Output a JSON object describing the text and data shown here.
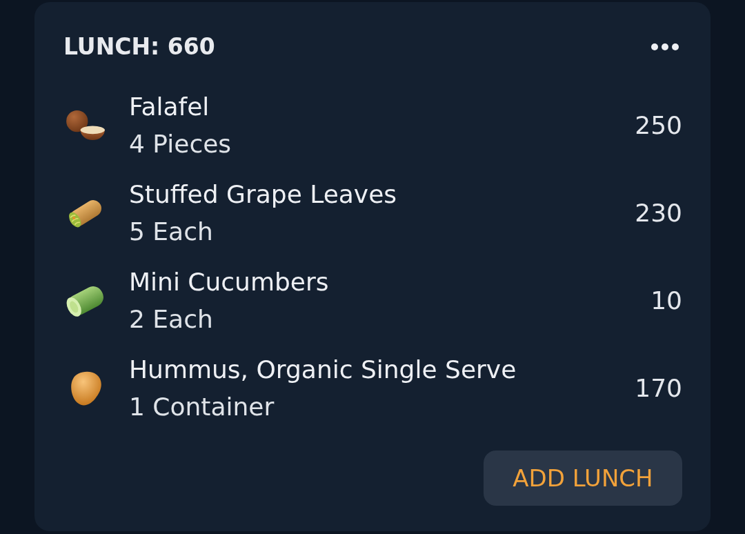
{
  "meal": {
    "title": "LUNCH: 660",
    "items": [
      {
        "name": "Falafel",
        "serving": "4 Pieces",
        "calories": "250"
      },
      {
        "name": "Stuffed Grape Leaves",
        "serving": "5 Each",
        "calories": "230"
      },
      {
        "name": "Mini Cucumbers",
        "serving": "2 Each",
        "calories": "10"
      },
      {
        "name": "Hummus, Organic Single Serve",
        "serving": "1 Container",
        "calories": "170"
      }
    ],
    "add_button": "ADD LUNCH"
  }
}
